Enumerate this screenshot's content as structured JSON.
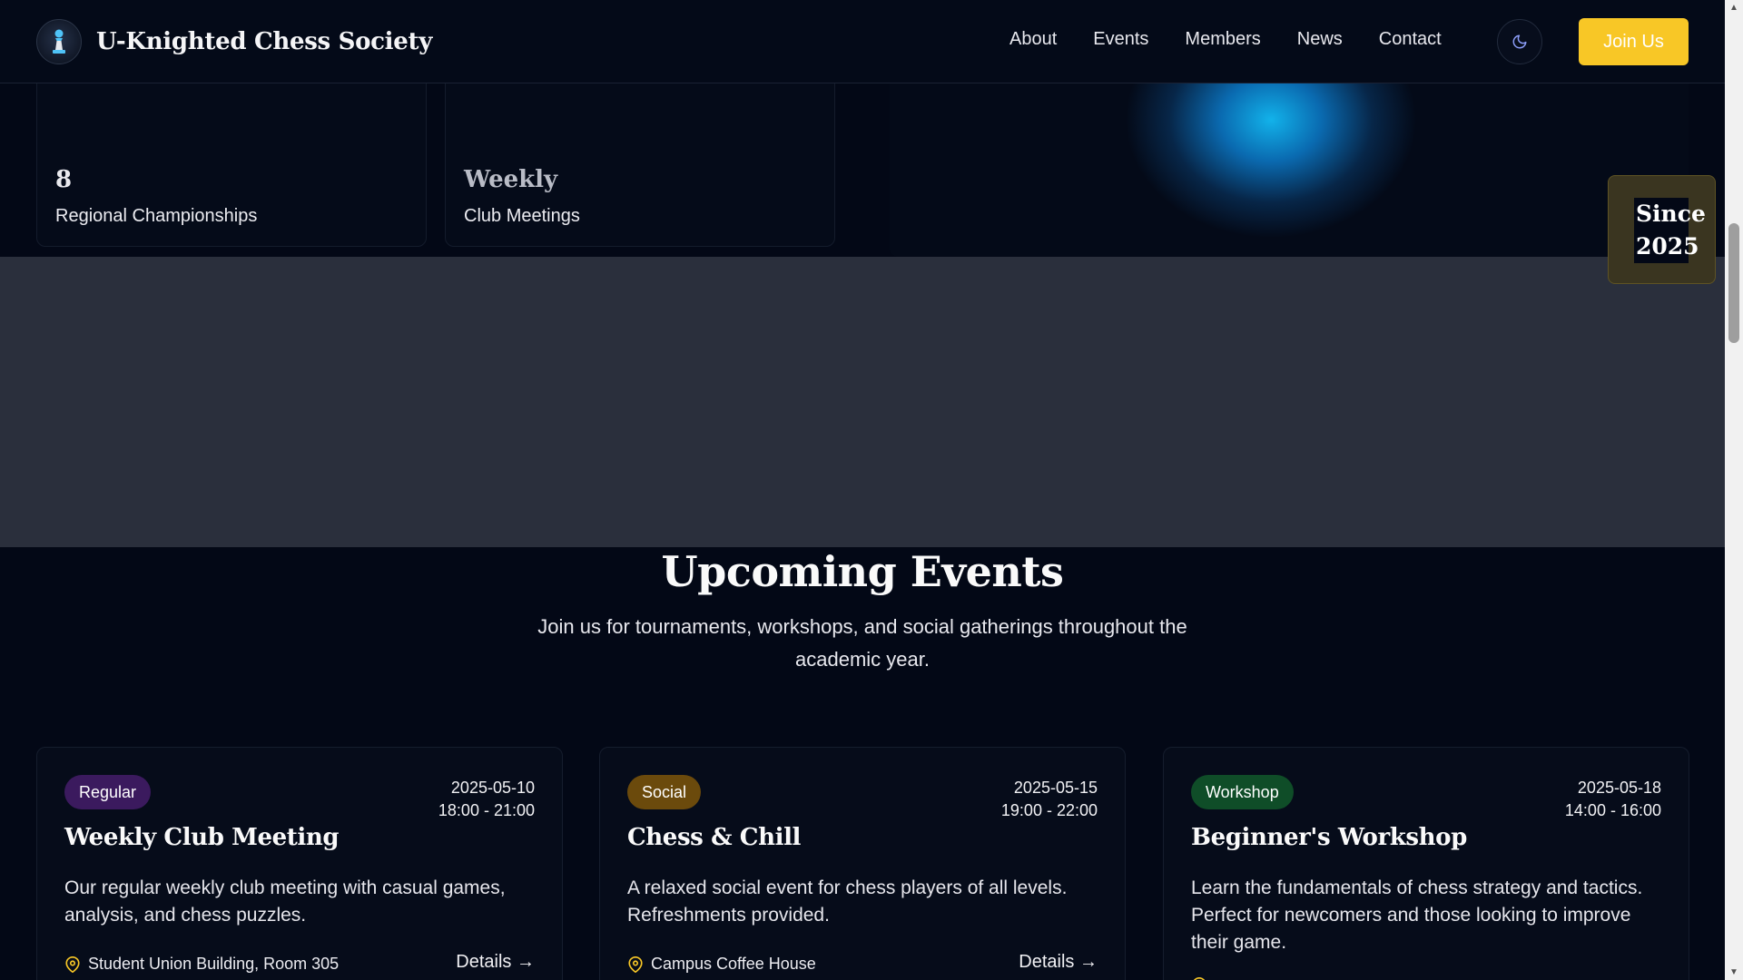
{
  "nav": {
    "brand": "U-Knighted Chess Society",
    "links": [
      "About",
      "Events",
      "Members",
      "News",
      "Contact"
    ],
    "join_label": "Join Us",
    "logo_icon": "chess-pawn-icon",
    "theme_icon": "moon-icon"
  },
  "hero": {
    "stats": [
      {
        "value": "8",
        "label": "Regional Championships"
      },
      {
        "value": "Weekly",
        "label": "Club Meetings"
      }
    ],
    "since_badge": "Since 2025"
  },
  "events": {
    "title": "Upcoming Events",
    "subtitle": "Join us for tournaments, workshops, and social gatherings throughout the academic year.",
    "items": [
      {
        "tag": "Regular",
        "date": "2025-05-10",
        "time": "18:00 - 21:00",
        "title": "Weekly Club Meeting",
        "description": "Our regular weekly club meeting with casual games, analysis, and chess puzzles.",
        "location": "Student Union Building, Room 305",
        "details_label": "Details →"
      },
      {
        "tag": "Social",
        "date": "2025-05-15",
        "time": "19:00 - 22:00",
        "title": "Chess & Chill",
        "description": "A relaxed social event for chess players of all levels. Refreshments provided.",
        "location": "Campus Coffee House",
        "details_label": "Details →"
      },
      {
        "tag": "Workshop",
        "date": "2025-05-18",
        "time": "14:00 - 16:00",
        "title": "Beginner's Workshop",
        "description": "Learn the fundamentals of chess strategy and tactics. Perfect for newcomers and those looking to improve their game.",
        "location": "",
        "details_label": ""
      }
    ]
  },
  "colors": {
    "accent": "#f8c726",
    "background": "#030816",
    "regular_badge": "#3b1a5e",
    "social_badge": "#6b4a0c",
    "workshop_badge": "#0f4d28"
  }
}
